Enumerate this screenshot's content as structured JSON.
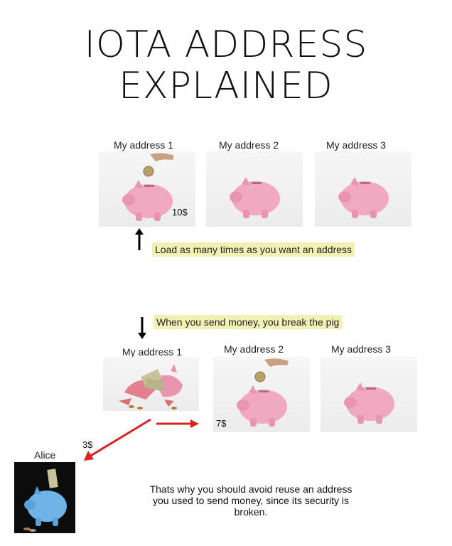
{
  "title": {
    "line1": "IOTA ADDRESS",
    "line2": "EXPLAINED"
  },
  "top_row": {
    "labels": [
      "My address 1",
      "My address 2",
      "My address 3"
    ],
    "amount": "10$",
    "note": "Load as many times as you want an address"
  },
  "bottom_row": {
    "note": "When you send money, you break the pig",
    "labels": [
      "My address 1",
      "My address 2",
      "My address 3"
    ],
    "amount_to_address2": "7$",
    "amount_to_alice": "3$",
    "alice_label": "Alice"
  },
  "explanation": "Thats why you should avoid reuse an address you used to send money, since its security is broken.",
  "colors": {
    "highlight": "#f3f0b4",
    "arrow_red": "#d9231e",
    "pig_pink": "#f0a9c0",
    "pig_blue": "#6fb4e6"
  }
}
